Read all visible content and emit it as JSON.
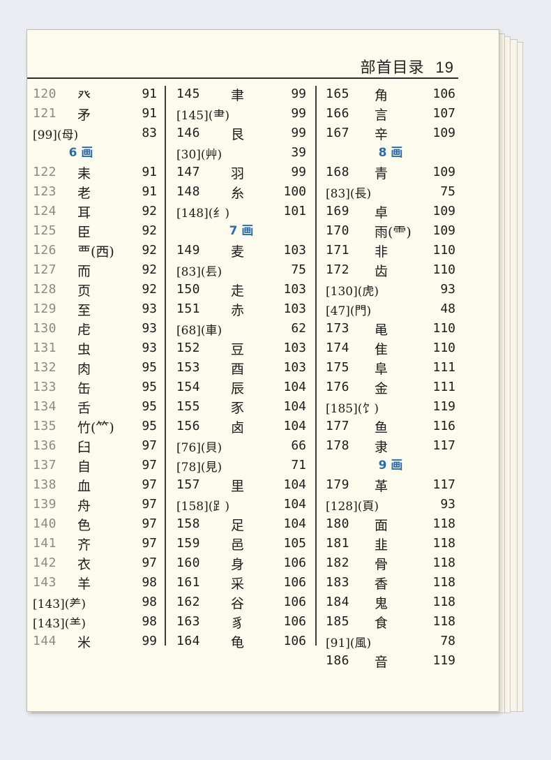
{
  "header": {
    "title": "部首目录",
    "page_number": "19"
  },
  "columns": [
    [
      {
        "type": "row",
        "num": "120",
        "char": "癶",
        "page": "91"
      },
      {
        "type": "row",
        "num": "121",
        "char": "矛",
        "page": "91"
      },
      {
        "type": "row",
        "full": "[99](母)",
        "page": "83"
      },
      {
        "type": "section",
        "label": "6 画"
      },
      {
        "type": "row",
        "num": "122",
        "char": "耒",
        "page": "91"
      },
      {
        "type": "row",
        "num": "123",
        "char": "老",
        "page": "91"
      },
      {
        "type": "row",
        "num": "124",
        "char": "耳",
        "page": "92"
      },
      {
        "type": "row",
        "num": "125",
        "char": "臣",
        "page": "92"
      },
      {
        "type": "row",
        "num": "126",
        "char": "覀(西)",
        "page": "92"
      },
      {
        "type": "row",
        "num": "127",
        "char": "而",
        "page": "92"
      },
      {
        "type": "row",
        "num": "128",
        "char": "页",
        "page": "92"
      },
      {
        "type": "row",
        "num": "129",
        "char": "至",
        "page": "93"
      },
      {
        "type": "row",
        "num": "130",
        "char": "虍",
        "page": "93"
      },
      {
        "type": "row",
        "num": "131",
        "char": "虫",
        "page": "93"
      },
      {
        "type": "row",
        "num": "132",
        "char": "肉",
        "page": "95"
      },
      {
        "type": "row",
        "num": "133",
        "char": "缶",
        "page": "95"
      },
      {
        "type": "row",
        "num": "134",
        "char": "舌",
        "page": "95"
      },
      {
        "type": "row",
        "num": "135",
        "char": "竹(⺮)",
        "page": "95"
      },
      {
        "type": "row",
        "num": "136",
        "char": "臼",
        "page": "97"
      },
      {
        "type": "row",
        "num": "137",
        "char": "自",
        "page": "97"
      },
      {
        "type": "row",
        "num": "138",
        "char": "血",
        "page": "97"
      },
      {
        "type": "row",
        "num": "139",
        "char": "舟",
        "page": "97"
      },
      {
        "type": "row",
        "num": "140",
        "char": "色",
        "page": "97"
      },
      {
        "type": "row",
        "num": "141",
        "char": "齐",
        "page": "97"
      },
      {
        "type": "row",
        "num": "142",
        "char": "衣",
        "page": "97"
      },
      {
        "type": "row",
        "num": "143",
        "char": "羊",
        "page": "98"
      },
      {
        "type": "row",
        "full": "[143](⺶)",
        "page": "98"
      },
      {
        "type": "row",
        "full": "[143](⺷)",
        "page": "98"
      },
      {
        "type": "row",
        "num": "144",
        "char": "米",
        "page": "99"
      }
    ],
    [
      {
        "type": "row",
        "num": "145",
        "char": "聿",
        "page": "99"
      },
      {
        "type": "row",
        "full": "[145](⺻)",
        "page": "99"
      },
      {
        "type": "row",
        "num": "146",
        "char": "艮",
        "page": "99"
      },
      {
        "type": "row",
        "full": "[30](艸)",
        "page": "39"
      },
      {
        "type": "row",
        "num": "147",
        "char": "羽",
        "page": "99"
      },
      {
        "type": "row",
        "num": "148",
        "char": "糸",
        "page": "100"
      },
      {
        "type": "row",
        "full": "[148](纟)",
        "page": "101"
      },
      {
        "type": "section",
        "label": "7 画"
      },
      {
        "type": "row",
        "num": "149",
        "char": "麦",
        "page": "103"
      },
      {
        "type": "row",
        "full": "[83](镸)",
        "page": "75"
      },
      {
        "type": "row",
        "num": "150",
        "char": "走",
        "page": "103"
      },
      {
        "type": "row",
        "num": "151",
        "char": "赤",
        "page": "103"
      },
      {
        "type": "row",
        "full": "[68](車)",
        "page": "62"
      },
      {
        "type": "row",
        "num": "152",
        "char": "豆",
        "page": "103"
      },
      {
        "type": "row",
        "num": "153",
        "char": "酉",
        "page": "103"
      },
      {
        "type": "row",
        "num": "154",
        "char": "辰",
        "page": "104"
      },
      {
        "type": "row",
        "num": "155",
        "char": "豕",
        "page": "104"
      },
      {
        "type": "row",
        "num": "156",
        "char": "卤",
        "page": "104"
      },
      {
        "type": "row",
        "full": "[76](貝)",
        "page": "66"
      },
      {
        "type": "row",
        "full": "[78](見)",
        "page": "71"
      },
      {
        "type": "row",
        "num": "157",
        "char": "里",
        "page": "104"
      },
      {
        "type": "row",
        "full": "[158](⻊)",
        "page": "104"
      },
      {
        "type": "row",
        "num": "158",
        "char": "足",
        "page": "104"
      },
      {
        "type": "row",
        "num": "159",
        "char": "邑",
        "page": "105"
      },
      {
        "type": "row",
        "num": "160",
        "char": "身",
        "page": "106"
      },
      {
        "type": "row",
        "num": "161",
        "char": "采",
        "page": "106"
      },
      {
        "type": "row",
        "num": "162",
        "char": "谷",
        "page": "106"
      },
      {
        "type": "row",
        "num": "163",
        "char": "豸",
        "page": "106"
      },
      {
        "type": "row",
        "num": "164",
        "char": "龟",
        "page": "106"
      }
    ],
    [
      {
        "type": "row",
        "num": "165",
        "char": "角",
        "page": "106"
      },
      {
        "type": "row",
        "num": "166",
        "char": "言",
        "page": "107"
      },
      {
        "type": "row",
        "num": "167",
        "char": "辛",
        "page": "109"
      },
      {
        "type": "section",
        "label": "8 画"
      },
      {
        "type": "row",
        "num": "168",
        "char": "青",
        "page": "109"
      },
      {
        "type": "row",
        "full": "[83](長)",
        "page": "75"
      },
      {
        "type": "row",
        "num": "169",
        "char": "卓",
        "page": "109"
      },
      {
        "type": "row",
        "num": "170",
        "char": "雨(⻗)",
        "page": "109"
      },
      {
        "type": "row",
        "num": "171",
        "char": "非",
        "page": "110"
      },
      {
        "type": "row",
        "num": "172",
        "char": "齿",
        "page": "110"
      },
      {
        "type": "row",
        "full": "[130](虎)",
        "page": "93"
      },
      {
        "type": "row",
        "full": "[47](門)",
        "page": "48"
      },
      {
        "type": "row",
        "num": "173",
        "char": "黾",
        "page": "110"
      },
      {
        "type": "row",
        "num": "174",
        "char": "隹",
        "page": "110"
      },
      {
        "type": "row",
        "num": "175",
        "char": "阜",
        "page": "111"
      },
      {
        "type": "row",
        "num": "176",
        "char": "金",
        "page": "111"
      },
      {
        "type": "row",
        "full": "[185](饣)",
        "page": "119"
      },
      {
        "type": "row",
        "num": "177",
        "char": "鱼",
        "page": "116"
      },
      {
        "type": "row",
        "num": "178",
        "char": "隶",
        "page": "117"
      },
      {
        "type": "section",
        "label": "9 画"
      },
      {
        "type": "row",
        "num": "179",
        "char": "革",
        "page": "117"
      },
      {
        "type": "row",
        "full": "[128](頁)",
        "page": "93"
      },
      {
        "type": "row",
        "num": "180",
        "char": "面",
        "page": "118"
      },
      {
        "type": "row",
        "num": "181",
        "char": "韭",
        "page": "118"
      },
      {
        "type": "row",
        "num": "182",
        "char": "骨",
        "page": "118"
      },
      {
        "type": "row",
        "num": "183",
        "char": "香",
        "page": "118"
      },
      {
        "type": "row",
        "num": "184",
        "char": "鬼",
        "page": "118"
      },
      {
        "type": "row",
        "num": "185",
        "char": "食",
        "page": "118"
      },
      {
        "type": "row",
        "full": "[91](風)",
        "page": "78"
      },
      {
        "type": "row",
        "num": "186",
        "char": "音",
        "page": "119"
      }
    ]
  ]
}
